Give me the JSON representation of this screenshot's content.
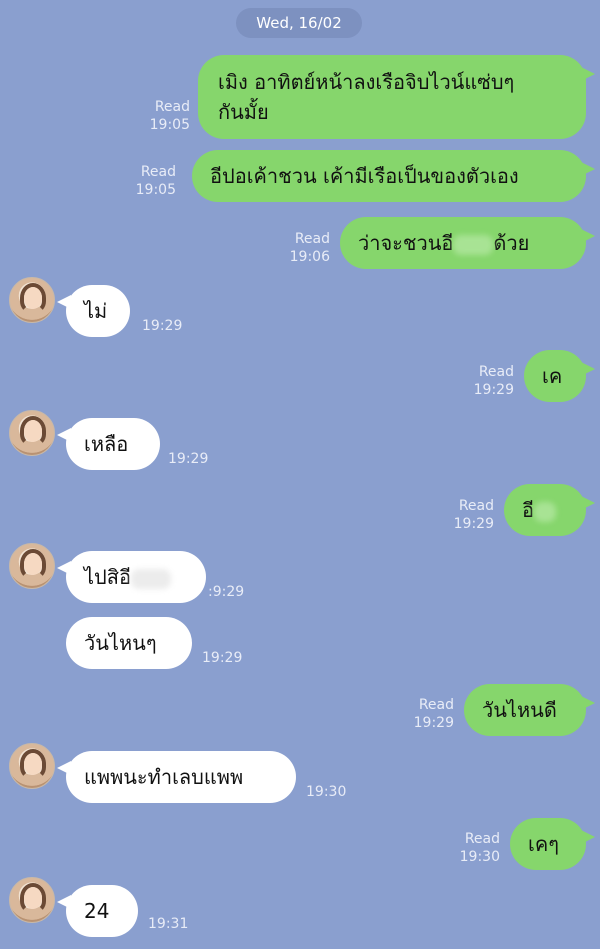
{
  "date": "Wed, 16/02",
  "messages": [
    {
      "dir": "out",
      "lines": [
        "เมิง อาทิตย์หน้าลงเรือจิบไวน์แซ่บๆ",
        "กันมั้ย"
      ],
      "status": "Read",
      "time": "19:05"
    },
    {
      "dir": "out",
      "text": "อีปอเค้าชวน เค้ามีเรือเป็นของตัวเอง",
      "status": "Read",
      "time": "19:05"
    },
    {
      "dir": "out",
      "text_before": "ว่าจะชวนอี",
      "text_after": "ด้วย",
      "status": "Read",
      "time": "19:06"
    },
    {
      "dir": "in",
      "text": "ไม่",
      "time": "19:29"
    },
    {
      "dir": "out",
      "text": "เค",
      "status": "Read",
      "time": "19:29"
    },
    {
      "dir": "in",
      "text": "เหลือ",
      "time": "19:29"
    },
    {
      "dir": "out",
      "text": "อี",
      "status": "Read",
      "time": "19:29"
    },
    {
      "dir": "in",
      "text": "ไปสิอี",
      "time": ":9:29"
    },
    {
      "dir": "in",
      "text": "วันไหนๆ",
      "time": "19:29"
    },
    {
      "dir": "out",
      "text": "วันไหนดี",
      "status": "Read",
      "time": "19:29"
    },
    {
      "dir": "in",
      "text": "แพพนะทำเลบแพพ",
      "time": "19:30"
    },
    {
      "dir": "out",
      "text": "เคๆ",
      "status": "Read",
      "time": "19:30"
    },
    {
      "dir": "in",
      "text": "24",
      "time": "19:31"
    }
  ]
}
